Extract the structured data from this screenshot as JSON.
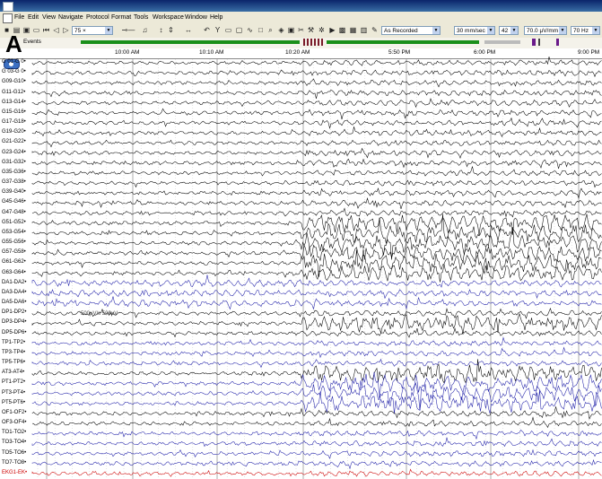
{
  "figure_letter": "A",
  "menu": [
    "File",
    "Edit",
    "View",
    "Navigate",
    "Protocol",
    "Format",
    "Tools",
    "Workspace",
    "Window",
    "Help"
  ],
  "toolbar": {
    "page_combo": "75 ×",
    "montage_combo": "As Recorded",
    "speed_combo": "30 mm/sec",
    "number_combo": "42",
    "sensitivity_combo": "70.0 μV/mm",
    "filter_combo": "70 Hz"
  },
  "events_label": "Events",
  "time_labels": [
    "10:00 AM",
    "10:10 AM",
    "10:20 AM",
    "5:50 PM",
    "6:00 PM",
    "9:00 PM"
  ],
  "scale_annotation": "500μV/s  500μV",
  "channels": [
    {
      "label": "G 01-G 0",
      "color": "black"
    },
    {
      "label": "G 03-G 0",
      "color": "black"
    },
    {
      "label": "G09-G10",
      "color": "black"
    },
    {
      "label": "G11-G12",
      "color": "black"
    },
    {
      "label": "G13-G14",
      "color": "black"
    },
    {
      "label": "G15-G16",
      "color": "black"
    },
    {
      "label": "G17-G18",
      "color": "black"
    },
    {
      "label": "G19-G20",
      "color": "black"
    },
    {
      "label": "G21-G22",
      "color": "black"
    },
    {
      "label": "G23-G24",
      "color": "black"
    },
    {
      "label": "G31-G32",
      "color": "black"
    },
    {
      "label": "G35-G36",
      "color": "black"
    },
    {
      "label": "G37-G38",
      "color": "black"
    },
    {
      "label": "G39-G40",
      "color": "black"
    },
    {
      "label": "G45-G46",
      "color": "black"
    },
    {
      "label": "G47-G48",
      "color": "black"
    },
    {
      "label": "G51-G52",
      "color": "black"
    },
    {
      "label": "G53-G54",
      "color": "black"
    },
    {
      "label": "G55-G56",
      "color": "black"
    },
    {
      "label": "G57-G58",
      "color": "black"
    },
    {
      "label": "G61-G62",
      "color": "black"
    },
    {
      "label": "G63-G64",
      "color": "black"
    },
    {
      "label": "DA1-DA2",
      "color": "blue"
    },
    {
      "label": "DA3-DA4",
      "color": "blue"
    },
    {
      "label": "DA5-DA6",
      "color": "blue"
    },
    {
      "label": "DP1-DP2",
      "color": "black"
    },
    {
      "label": "DP3-DP4",
      "color": "black"
    },
    {
      "label": "DP5-DP6",
      "color": "black"
    },
    {
      "label": "TP1-TP2",
      "color": "blue"
    },
    {
      "label": "TP3-TP4",
      "color": "blue"
    },
    {
      "label": "TP5-TP6",
      "color": "blue"
    },
    {
      "label": "AT3-AT4",
      "color": "black"
    },
    {
      "label": "PT1-PT2",
      "color": "blue"
    },
    {
      "label": "PT3-PT4",
      "color": "blue"
    },
    {
      "label": "PT5-PT6",
      "color": "blue"
    },
    {
      "label": "OF1-OF2",
      "color": "black"
    },
    {
      "label": "OF3-OF4",
      "color": "black"
    },
    {
      "label": "TO1-TO2",
      "color": "blue"
    },
    {
      "label": "TO3-TO4",
      "color": "blue"
    },
    {
      "label": "TO5-TO6",
      "color": "blue"
    },
    {
      "label": "TO7-TO8",
      "color": "blue"
    },
    {
      "label": "EKG1-EK",
      "color": "red"
    }
  ],
  "colors": {
    "black": "#000000",
    "blue": "#1f1fa8",
    "red": "#cc0000",
    "grid": "#9a9a9a"
  }
}
